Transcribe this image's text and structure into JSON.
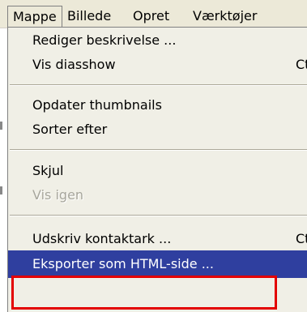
{
  "menubar": {
    "items": [
      "Mappe",
      "Billede",
      "Opret",
      "Værktøjer"
    ],
    "open_index": 0
  },
  "menu": {
    "items": [
      {
        "label": "Rediger beskrivelse ...",
        "accel": "",
        "state": "normal"
      },
      {
        "label": "Vis diasshow",
        "accel": "Ctrl-",
        "state": "normal"
      },
      {
        "label": "Opdater thumbnails",
        "accel": "",
        "state": "normal"
      },
      {
        "label": "Sorter efter",
        "accel": "",
        "state": "normal"
      },
      {
        "label": "Skjul",
        "accel": "",
        "state": "normal"
      },
      {
        "label": "Vis igen",
        "accel": "",
        "state": "disabled"
      },
      {
        "label": "Udskriv kontaktark ...",
        "accel": "Ctrl-",
        "state": "normal"
      },
      {
        "label": "Eksporter som HTML-side ...",
        "accel": "",
        "state": "highlighted"
      }
    ]
  },
  "colors": {
    "highlight": "#2f3f9f",
    "callout": "#e30000",
    "disabled_text": "#a7a69c"
  }
}
